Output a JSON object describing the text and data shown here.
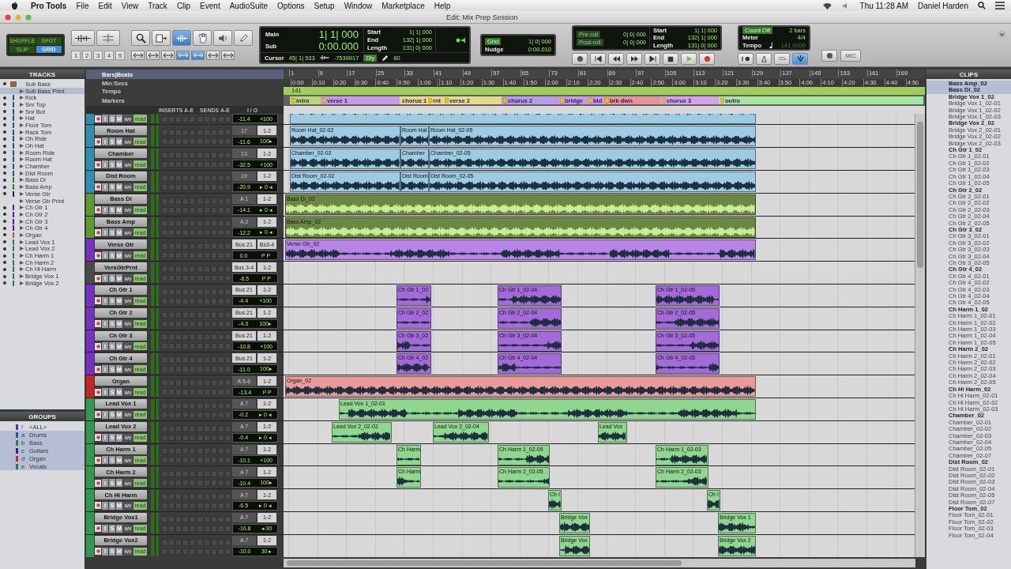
{
  "menubar": {
    "app": "Pro Tools",
    "menus": [
      "File",
      "Edit",
      "View",
      "Track",
      "Clip",
      "Event",
      "AudioSuite",
      "Options",
      "Setup",
      "Window",
      "Marketplace",
      "Help"
    ],
    "clock": "Thu 11:28 AM",
    "user": "Daniel Harden"
  },
  "window": {
    "title": "Edit: Mix Prep Session"
  },
  "edit_modes": [
    {
      "label": "SHUFFLE",
      "selected": false
    },
    {
      "label": "SPOT",
      "selected": false
    },
    {
      "label": "SLIP",
      "selected": false
    },
    {
      "label": "GRID",
      "selected": true
    }
  ],
  "zoom_presets": [
    "1",
    "2",
    "3",
    "4",
    "5"
  ],
  "tools": [
    {
      "selected": false
    },
    {
      "selected": false
    },
    {
      "selected": true
    },
    {
      "selected": false
    },
    {
      "selected": false
    },
    {
      "selected": false
    }
  ],
  "mode_toggles": [
    {
      "selected": false
    },
    {
      "selected": false
    },
    {
      "selected": false
    },
    {
      "selected": true
    },
    {
      "selected": true
    },
    {
      "selected": false
    },
    {
      "selected": false
    }
  ],
  "counter": {
    "main_label": "Main",
    "main": "1| 1| 000",
    "sub_label": "Sub",
    "sub": "0:00.000",
    "fields": [
      {
        "label": "Start",
        "value": "1| 1| 000"
      },
      {
        "label": "End",
        "value": "132| 1| 000"
      },
      {
        "label": "Length",
        "value": "131| 0| 000"
      }
    ],
    "cursor_label": "Cursor",
    "cursor": "45| 1| 533",
    "sample": "-7539917",
    "delay": "Dly",
    "value": "80"
  },
  "grid": {
    "label": "Grid",
    "value": "1| 0| 000",
    "nudge_label": "Nudge",
    "nudge": "0:00.010"
  },
  "roll_panel": {
    "rolls": [
      {
        "label": "Pre-roll",
        "value": "0| 0| 000"
      },
      {
        "label": "Post-roll",
        "value": "0| 0| 000"
      }
    ],
    "fields": [
      {
        "label": "Start",
        "value": "1| 1| 000"
      },
      {
        "label": "End",
        "value": "132| 1| 000"
      },
      {
        "label": "Length",
        "value": "131| 0| 000"
      }
    ]
  },
  "count_panel": {
    "count_off": "Count Off",
    "count_value": "2 bars",
    "meter_label": "Meter",
    "meter": "4/4",
    "tempo_label": "Tempo",
    "tempo": "141.0000"
  },
  "mic_button": "MIC",
  "tracks_panel": {
    "title": "TRACKS",
    "items": [
      {
        "name": "Sub Bass",
        "kind": "group",
        "shown": true,
        "selected": false,
        "color": "#8a6a3a"
      },
      {
        "name": "Sub Bass Print",
        "kind": "track",
        "shown": false,
        "selected": true
      },
      {
        "name": "Kick",
        "kind": "track",
        "shown": true,
        "selected": false,
        "color": "#2a4f8a"
      },
      {
        "name": "Snr Top",
        "kind": "track",
        "shown": true,
        "selected": false,
        "color": "#2a4f8a"
      },
      {
        "name": "Snr Bot",
        "kind": "track",
        "shown": true,
        "selected": false,
        "color": "#2a4f8a"
      },
      {
        "name": "Hat",
        "kind": "track",
        "shown": true,
        "selected": false,
        "color": "#2a4f8a"
      },
      {
        "name": "Floor Tom",
        "kind": "track",
        "shown": true,
        "selected": false,
        "color": "#2a4f8a"
      },
      {
        "name": "Rack Tom",
        "kind": "track",
        "shown": true,
        "selected": false,
        "color": "#2a4f8a"
      },
      {
        "name": "Oh Ride",
        "kind": "track",
        "shown": true,
        "selected": false,
        "color": "#2a4f8a"
      },
      {
        "name": "Oh Hat",
        "kind": "track",
        "shown": true,
        "selected": false,
        "color": "#2a4f8a"
      },
      {
        "name": "Room Ride",
        "kind": "track",
        "shown": true,
        "selected": false,
        "color": "#2a4f8a"
      },
      {
        "name": "Room Hat",
        "kind": "track",
        "shown": true,
        "selected": false,
        "color": "#2a4f8a"
      },
      {
        "name": "Chamber",
        "kind": "track",
        "shown": true,
        "selected": false,
        "color": "#2a4f8a"
      },
      {
        "name": "Dist Room",
        "kind": "track",
        "shown": true,
        "selected": false,
        "color": "#2a4f8a"
      },
      {
        "name": "Bass Di",
        "kind": "track",
        "shown": true,
        "selected": false,
        "color": "#3a7a3a"
      },
      {
        "name": "Bass Amp",
        "kind": "track",
        "shown": true,
        "selected": false,
        "color": "#3a7a3a"
      },
      {
        "name": "Verse Gtr",
        "kind": "track",
        "shown": true,
        "selected": false,
        "color": "#1e1e6e"
      },
      {
        "name": "Verse Gtr Print",
        "kind": "track",
        "shown": false,
        "selected": false
      },
      {
        "name": "Ch Gtr 1",
        "kind": "track",
        "shown": true,
        "selected": false,
        "color": "#5a1a9a"
      },
      {
        "name": "Ch Gtr 2",
        "kind": "track",
        "shown": true,
        "selected": false,
        "color": "#5a1a9a"
      },
      {
        "name": "Ch Gtr 3",
        "kind": "track",
        "shown": true,
        "selected": false,
        "color": "#5a1a9a"
      },
      {
        "name": "Ch Gtr 4",
        "kind": "track",
        "shown": true,
        "selected": false,
        "color": "#5a1a9a"
      },
      {
        "name": "Organ",
        "kind": "track",
        "shown": true,
        "selected": false,
        "color": "#d04060"
      },
      {
        "name": "Lead Vox 1",
        "kind": "track",
        "shown": true,
        "selected": false,
        "color": "#2a7a4a"
      },
      {
        "name": "Lead Vox 2",
        "kind": "track",
        "shown": true,
        "selected": false,
        "color": "#2a7a4a"
      },
      {
        "name": "Ch Harm 1",
        "kind": "track",
        "shown": true,
        "selected": false,
        "color": "#2a7a4a"
      },
      {
        "name": "Ch Harm 2",
        "kind": "track",
        "shown": true,
        "selected": false,
        "color": "#2a7a4a"
      },
      {
        "name": "Ch Hi Harm",
        "kind": "track",
        "shown": true,
        "selected": false,
        "color": "#2a7a4a"
      },
      {
        "name": "Bridge Vox 1",
        "kind": "track",
        "shown": true,
        "selected": false,
        "color": "#2a7a4a"
      },
      {
        "name": "Bridge Vox 2",
        "kind": "track",
        "shown": true,
        "selected": false,
        "color": "#2a7a4a"
      }
    ]
  },
  "groups_panel": {
    "title": "GROUPS",
    "items": [
      {
        "id": "!",
        "name": "<ALL>",
        "color": "#5a2ad0",
        "selected": false
      },
      {
        "id": "a",
        "name": "Drums",
        "color": "#2a5a8a",
        "selected": true
      },
      {
        "id": "b",
        "name": "Bass",
        "color": "#3a7a3a",
        "selected": true
      },
      {
        "id": "c",
        "name": "Guitars",
        "color": "#3a1a9a",
        "selected": true
      },
      {
        "id": "d",
        "name": "Organ",
        "color": "#c02a3a",
        "selected": true
      },
      {
        "id": "e",
        "name": "Vocals",
        "color": "#2a7a5a",
        "selected": true
      }
    ]
  },
  "rulers": {
    "labels": [
      "Bars|Beats",
      "Min:Secs",
      "Tempo",
      "Markers"
    ],
    "bars": [
      "1",
      "9",
      "17",
      "25",
      "33",
      "41",
      "49",
      "57",
      "65",
      "73",
      "81",
      "89",
      "97",
      "105",
      "113",
      "121",
      "129",
      "137",
      "145",
      "153",
      "161",
      "169"
    ],
    "minsecs": [
      "0:00",
      "0:10",
      "0:20",
      "0:30",
      "0:40",
      "0:50",
      "1:00",
      "1:10",
      "1:20",
      "1:30",
      "1:40",
      "1:50",
      "2:00",
      "2:10",
      "2:20",
      "2:30",
      "2:40",
      "2:50",
      "3:00",
      "3:10",
      "3:20",
      "3:30",
      "3:40",
      "3:50",
      "4:00",
      "4:10",
      "4:20",
      "4:30",
      "4:40",
      "4:50"
    ],
    "tempo": "141",
    "markers": [
      {
        "label": "intro",
        "color": "#b8d878"
      },
      {
        "label": "verse 1",
        "color": "#c69ae6"
      },
      {
        "label": "chorus 1",
        "color": "#e4d98c"
      },
      {
        "label": "rnt",
        "color": "#e4d98c"
      },
      {
        "label": "verse 2",
        "color": "#e4d98c"
      },
      {
        "label": "chorus 2",
        "color": "#b79ce9"
      },
      {
        "label": "bridge",
        "color": "#c69ae6"
      },
      {
        "label": "bld",
        "color": "#c69ae6"
      },
      {
        "label": "brk dwn",
        "color": "#e6939c"
      },
      {
        "label": "chorus 3",
        "color": "#d6a2ea"
      },
      {
        "label": "outro",
        "color": "#a8e6a4"
      }
    ]
  },
  "columns": [
    "INSERTS A-E",
    "SENDS A-E",
    "I / O"
  ],
  "tracks": [
    {
      "kind": "drums",
      "color": "#2e8fb0",
      "controls": [
        "I",
        "S",
        "M"
      ],
      "view": "wv",
      "automation": "read",
      "volume": "-11.4",
      "pan": "+100",
      "clips": [
        {
          "color": "#9ccbe3"
        }
      ]
    },
    {
      "kind": "drums",
      "name": "Room Hat",
      "color": "#2e8fb0",
      "controls": [
        "I",
        "S",
        "M"
      ],
      "view": "wv",
      "automation": "read",
      "input": "17",
      "input_active": false,
      "output": "1-2",
      "volume": "-11.6",
      "pan": "100▸",
      "clips": [
        {
          "name": "Room Hat_02-02",
          "color": "#9ccbe3"
        },
        {
          "name": "Room Hat",
          "color": "#9ccbe3"
        },
        {
          "name": "Room Hat_02-05",
          "color": "#9ccbe3"
        }
      ]
    },
    {
      "kind": "drums",
      "name": "Chamber",
      "color": "#2e8fb0",
      "controls": [
        "I",
        "S",
        "M"
      ],
      "view": "wv",
      "automation": "read",
      "input": "13",
      "input_active": false,
      "output": "1-2",
      "volume": "-32.5",
      "pan": "+100",
      "clips": [
        {
          "name": "Chamber_02-02",
          "color": "#9ccbe3"
        },
        {
          "name": "Chamber",
          "color": "#9ccbe3"
        },
        {
          "name": "Chamber_02-05",
          "color": "#9ccbe3"
        }
      ]
    },
    {
      "kind": "drums",
      "name": "Dist Room",
      "color": "#2e8fb0",
      "controls": [
        "I",
        "S",
        "M"
      ],
      "view": "wv",
      "automation": "read",
      "input": "19",
      "input_active": false,
      "output": "1-2",
      "volume": "-20.9",
      "pan": "▸ 0 ◂",
      "clips": [
        {
          "name": "Dist Room_02-02",
          "color": "#9ccbe3"
        },
        {
          "name": "Dist Room",
          "color": "#9ccbe3"
        },
        {
          "name": "Dist Room_02-05",
          "color": "#9ccbe3"
        }
      ]
    },
    {
      "kind": "bass",
      "name": "Bass Di",
      "color": "#5e9a2e",
      "controls": [
        "I",
        "S",
        "M"
      ],
      "view": "wv",
      "automation": "read",
      "input": "A 1",
      "input_active": false,
      "output": "1-2",
      "volume": "-14.1",
      "pan": "▸ 0 ◂",
      "clips": [
        {
          "name": "Bass Di_02",
          "color": "#6c8744"
        }
      ]
    },
    {
      "kind": "bass",
      "name": "Bass Amp",
      "color": "#5e9a2e",
      "controls": [
        "I",
        "S",
        "M"
      ],
      "view": "wv",
      "automation": "read",
      "input": "A 2",
      "input_active": false,
      "output": "1-2",
      "volume": "-12.2",
      "pan": "▸ 0 ◂",
      "clips": [
        {
          "name": "Bass Amp_02",
          "color": "#6c8744"
        }
      ]
    },
    {
      "kind": "guitar",
      "name": "Verse Gtr",
      "color": "#7a2fc4",
      "controls": [
        "I",
        "S",
        "M"
      ],
      "view": "wv",
      "automation": "read",
      "input": "Bus 21",
      "input_active": true,
      "output": "Bs3-4",
      "volume": "0.0",
      "pan": "P  P",
      "clips": [
        {
          "name": "Verse Gtr_02",
          "color": "#b884e8"
        }
      ]
    },
    {
      "name": "VersGtrPrnt",
      "color": "#4a4a4a",
      "controls": [
        "I",
        "S",
        "M"
      ],
      "view": "wv",
      "automation": "read",
      "input": "Bus 3-4",
      "input_active": true,
      "output": "1-2",
      "volume": "-6.5",
      "pan": "P  P"
    },
    {
      "kind": "guitar",
      "name": "Ch Gtr 1",
      "color": "#7a2fc4",
      "controls": [
        "I",
        "S",
        "M"
      ],
      "view": "wv",
      "automation": "read",
      "input": "Bus 21",
      "input_active": true,
      "output": "1-2",
      "volume": "-4.4",
      "pan": "+100",
      "clips": [
        {
          "name": "Ch Gtr 1_02",
          "color": "#a46ad9"
        },
        {
          "name": "Ch Gtr 1_02-04",
          "color": "#a46ad9"
        },
        {
          "name": "Ch Gtr 1_02-05",
          "color": "#a46ad9"
        }
      ]
    },
    {
      "kind": "guitar",
      "name": "Ch Gtr 2",
      "color": "#7a2fc4",
      "controls": [
        "I",
        "S",
        "M"
      ],
      "view": "wv",
      "automation": "read",
      "input": "Bus 21",
      "input_active": true,
      "output": "1-2",
      "volume": "-4.3",
      "pan": "100▸",
      "clips": [
        {
          "name": "Ch Gtr 2_02",
          "color": "#a46ad9"
        },
        {
          "name": "Ch Gtr 2_02-04",
          "color": "#a46ad9"
        },
        {
          "name": "Ch Gtr 2_02-05",
          "color": "#a46ad9"
        }
      ]
    },
    {
      "kind": "guitar",
      "name": "Ch Gtr 3",
      "color": "#7a2fc4",
      "controls": [
        "I",
        "S",
        "M"
      ],
      "view": "wv",
      "automation": "read",
      "input": "Bus 21",
      "input_active": true,
      "output": "1-2",
      "volume": "-10.8",
      "pan": "+100",
      "clips": [
        {
          "name": "Ch Gtr 3_02",
          "color": "#a46ad9"
        },
        {
          "name": "Ch Gtr 3_02-04",
          "color": "#a46ad9"
        },
        {
          "name": "Ch Gtr 3_02-05",
          "color": "#a46ad9"
        }
      ]
    },
    {
      "kind": "guitar",
      "name": "Ch Gtr 4",
      "color": "#7a2fc4",
      "controls": [
        "I",
        "S",
        "M"
      ],
      "view": "wv",
      "automation": "read",
      "input": "Bus 21",
      "input_active": true,
      "output": "1-2",
      "volume": "-11.0",
      "pan": "100▸",
      "clips": [
        {
          "name": "Ch Gtr 4_02",
          "color": "#a46ad9"
        },
        {
          "name": "Ch Gtr 4_02-04",
          "color": "#a46ad9"
        },
        {
          "name": "Ch Gtr 4_02-05",
          "color": "#a46ad9"
        }
      ]
    },
    {
      "kind": "keys",
      "name": "Organ",
      "color": "#c42424",
      "controls": [
        "I",
        "S",
        "M"
      ],
      "view": "wv",
      "automation": "read",
      "input": "A 5-6",
      "input_active": false,
      "output": "1-2",
      "volume": "-13.4",
      "pan": "P  P",
      "clips": [
        {
          "name": "Organ_02",
          "color": "#eb9a9a"
        }
      ]
    },
    {
      "kind": "vocal",
      "name": "Lead Vox 1",
      "color": "#2f9a4e",
      "controls": [
        "I",
        "S",
        "M"
      ],
      "view": "wv",
      "automation": "read",
      "input": "A 7",
      "input_active": false,
      "output": "1-2",
      "volume": "-0.2",
      "pan": "▸ 0 ◂",
      "clips": [
        {
          "name": "Lead Vox 1_02-01",
          "color": "#8fd68f"
        }
      ]
    },
    {
      "kind": "vocal",
      "name": "Lead Vox 2",
      "color": "#2f9a4e",
      "controls": [
        "I",
        "S",
        "M"
      ],
      "view": "wv",
      "automation": "read",
      "input": "A 7",
      "input_active": false,
      "output": "1-2",
      "volume": "-0.4",
      "pan": "▸ 0 ◂",
      "clips": [
        {
          "name": "Lead Vox 2_02-02",
          "color": "#8fd68f"
        },
        {
          "name": "Lead Vox 2_02-04",
          "color": "#8fd68f"
        },
        {
          "name": "Lead Vox",
          "color": "#8fd68f"
        }
      ]
    },
    {
      "kind": "vocal",
      "name": "Ch Harm 1",
      "color": "#2f9a4e",
      "controls": [
        "I",
        "S",
        "M"
      ],
      "view": "wv",
      "automation": "read",
      "input": "A 7",
      "input_active": false,
      "output": "1-2",
      "volume": "-10.1",
      "pan": "+100",
      "clips": [
        {
          "name": "Ch Harm",
          "color": "#8fd68f"
        },
        {
          "name": "Ch Harm 1_02-05",
          "color": "#8fd68f"
        },
        {
          "name": "Ch Harm 1_02-03",
          "color": "#8fd68f"
        }
      ]
    },
    {
      "kind": "vocal",
      "name": "Ch Harm 2",
      "color": "#2f9a4e",
      "controls": [
        "I",
        "S",
        "M"
      ],
      "view": "wv",
      "automation": "read",
      "input": "A 7",
      "input_active": false,
      "output": "1-2",
      "volume": "-10.4",
      "pan": "100▸",
      "clips": [
        {
          "name": "Ch Harm",
          "color": "#8fd68f"
        },
        {
          "name": "Ch Harm 2_02-05",
          "color": "#8fd68f"
        },
        {
          "name": "Ch Harm 2_02-03",
          "color": "#8fd68f"
        }
      ]
    },
    {
      "kind": "vocal",
      "name": "Ch Hi Harm",
      "color": "#2f9a4e",
      "controls": [
        "I",
        "S",
        "M"
      ],
      "view": "wv",
      "automation": "read",
      "input": "A 7",
      "input_active": false,
      "output": "1-2",
      "volume": "-6.5",
      "pan": "▸ 0 ◂",
      "clips": [
        {
          "name": "Ch I",
          "color": "#8fd68f"
        },
        {
          "name": "Ch I",
          "color": "#8fd68f"
        }
      ]
    },
    {
      "kind": "vocal",
      "name": "Bridge Vox1",
      "color": "#2f9a4e",
      "controls": [
        "I",
        "S",
        "M"
      ],
      "view": "wv",
      "automation": "read",
      "input": "A 7",
      "input_active": false,
      "output": "1-2",
      "volume": "-10.8",
      "pan": "◂ 30",
      "clips": [
        {
          "name": "Bridge Vox",
          "color": "#8fd68f"
        },
        {
          "name": "Bridge Vox 1",
          "color": "#8fd68f"
        }
      ]
    },
    {
      "kind": "vocal",
      "name": "Bridge Vox2",
      "color": "#2f9a4e",
      "controls": [
        "I",
        "S",
        "M"
      ],
      "view": "wv",
      "automation": "read",
      "input": "A 7",
      "input_active": false,
      "output": "1-2",
      "volume": "-10.0",
      "pan": "30 ▸",
      "clips": [
        {
          "name": "Bridge Vox",
          "color": "#8fd68f"
        },
        {
          "name": "Bridge Vox 2",
          "color": "#8fd68f"
        }
      ]
    }
  ],
  "clips_panel": {
    "title": "CLIPS",
    "items": [
      {
        "name": "Bass Amp_02",
        "whole": true,
        "selected": true
      },
      {
        "name": "Bass Di_02",
        "whole": true,
        "selected": true
      },
      {
        "name": "Bridge Vox 1_02",
        "whole": true,
        "selected": false
      },
      {
        "name": "Bridge Vox 1_02-01",
        "whole": false,
        "selected": false
      },
      {
        "name": "Bridge Vox 1_02-02",
        "whole": false,
        "selected": false
      },
      {
        "name": "Bridge Vox 1_02-03",
        "whole": false,
        "selected": false
      },
      {
        "name": "Bridge Vox 2_02",
        "whole": true,
        "selected": false
      },
      {
        "name": "Bridge Vox 2_02-01",
        "whole": false,
        "selected": false
      },
      {
        "name": "Bridge Vox 2_02-02",
        "whole": false,
        "selected": false
      },
      {
        "name": "Bridge Vox 2_02-03",
        "whole": false,
        "selected": false
      },
      {
        "name": "Ch Gtr 1_02",
        "whole": true,
        "selected": false
      },
      {
        "name": "Ch Gtr 1_02-01",
        "whole": false,
        "selected": false
      },
      {
        "name": "Ch Gtr 1_02-02",
        "whole": false,
        "selected": false
      },
      {
        "name": "Ch Gtr 1_02-03",
        "whole": false,
        "selected": false
      },
      {
        "name": "Ch Gtr 1_02-04",
        "whole": false,
        "selected": false
      },
      {
        "name": "Ch Gtr 1_02-05",
        "whole": false,
        "selected": false
      },
      {
        "name": "Ch Gtr 2_02",
        "whole": true,
        "selected": false
      },
      {
        "name": "Ch Gtr 2_02-01",
        "whole": false,
        "selected": false
      },
      {
        "name": "Ch Gtr 2_02-02",
        "whole": false,
        "selected": false
      },
      {
        "name": "Ch Gtr 2_02-03",
        "whole": false,
        "selected": false
      },
      {
        "name": "Ch Gtr 2_02-04",
        "whole": false,
        "selected": false
      },
      {
        "name": "Ch Gtr 2_02-05",
        "whole": false,
        "selected": false
      },
      {
        "name": "Ch Gtr 3_02",
        "whole": true,
        "selected": false
      },
      {
        "name": "Ch Gtr 3_02-01",
        "whole": false,
        "selected": false
      },
      {
        "name": "Ch Gtr 3_02-02",
        "whole": false,
        "selected": false
      },
      {
        "name": "Ch Gtr 3_02-03",
        "whole": false,
        "selected": false
      },
      {
        "name": "Ch Gtr 3_02-04",
        "whole": false,
        "selected": false
      },
      {
        "name": "Ch Gtr 3_02-05",
        "whole": false,
        "selected": false
      },
      {
        "name": "Ch Gtr 4_02",
        "whole": true,
        "selected": false
      },
      {
        "name": "Ch Gtr 4_02-01",
        "whole": false,
        "selected": false
      },
      {
        "name": "Ch Gtr 4_02-02",
        "whole": false,
        "selected": false
      },
      {
        "name": "Ch Gtr 4_02-03",
        "whole": false,
        "selected": false
      },
      {
        "name": "Ch Gtr 4_02-04",
        "whole": false,
        "selected": false
      },
      {
        "name": "Ch Gtr 4_02-05",
        "whole": false,
        "selected": false
      },
      {
        "name": "Ch Harm 1_02",
        "whole": true,
        "selected": false
      },
      {
        "name": "Ch Harm 1_02-01",
        "whole": false,
        "selected": false
      },
      {
        "name": "Ch Harm 1_02-02",
        "whole": false,
        "selected": false
      },
      {
        "name": "Ch Harm 1_02-03",
        "whole": false,
        "selected": false
      },
      {
        "name": "Ch Harm 1_02-04",
        "whole": false,
        "selected": false
      },
      {
        "name": "Ch Harm 1_02-05",
        "whole": false,
        "selected": false
      },
      {
        "name": "Ch Harm 2_02",
        "whole": true,
        "selected": false
      },
      {
        "name": "Ch Harm 2_02-01",
        "whole": false,
        "selected": false
      },
      {
        "name": "Ch Harm 2_02-02",
        "whole": false,
        "selected": false
      },
      {
        "name": "Ch Harm 2_02-03",
        "whole": false,
        "selected": false
      },
      {
        "name": "Ch Harm 2_02-04",
        "whole": false,
        "selected": false
      },
      {
        "name": "Ch Harm 2_02-05",
        "whole": false,
        "selected": false
      },
      {
        "name": "Ch Hi Harm_02",
        "whole": true,
        "selected": false
      },
      {
        "name": "Ch Hi Harm_02-01",
        "whole": false,
        "selected": false
      },
      {
        "name": "Ch Hi Harm_02-02",
        "whole": false,
        "selected": false
      },
      {
        "name": "Ch Hi Harm_02-03",
        "whole": false,
        "selected": false
      },
      {
        "name": "Chamber_02",
        "whole": true,
        "selected": false
      },
      {
        "name": "Chamber_02-01",
        "whole": false,
        "selected": false
      },
      {
        "name": "Chamber_02-02",
        "whole": false,
        "selected": false
      },
      {
        "name": "Chamber_02-03",
        "whole": false,
        "selected": false
      },
      {
        "name": "Chamber_02-04",
        "whole": false,
        "selected": false
      },
      {
        "name": "Chamber_02-05",
        "whole": false,
        "selected": false
      },
      {
        "name": "Chamber_02-07",
        "whole": false,
        "selected": false
      },
      {
        "name": "Dist Room_02",
        "whole": true,
        "selected": false
      },
      {
        "name": "Dist Room_02-01",
        "whole": false,
        "selected": false
      },
      {
        "name": "Dist Room_02-02",
        "whole": false,
        "selected": false
      },
      {
        "name": "Dist Room_02-03",
        "whole": false,
        "selected": false
      },
      {
        "name": "Dist Room_02-04",
        "whole": false,
        "selected": false
      },
      {
        "name": "Dist Room_02-05",
        "whole": false,
        "selected": false
      },
      {
        "name": "Dist Room_02-07",
        "whole": false,
        "selected": false
      },
      {
        "name": "Floor Tom_02",
        "whole": true,
        "selected": false
      },
      {
        "name": "Floor Tom_02-01",
        "whole": false,
        "selected": false
      },
      {
        "name": "Floor Tom_02-02",
        "whole": false,
        "selected": false
      },
      {
        "name": "Floor Tom_02-03",
        "whole": false,
        "selected": false
      },
      {
        "name": "Floor Tom_02-04",
        "whole": false,
        "selected": false
      }
    ]
  }
}
